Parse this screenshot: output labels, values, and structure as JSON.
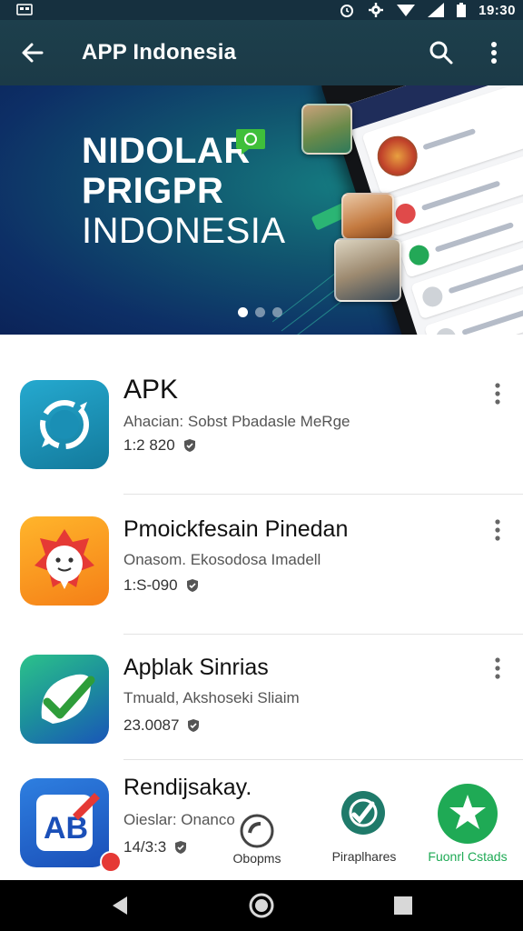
{
  "status_bar": {
    "time": "19:30"
  },
  "app_bar": {
    "title": "APP Indonesia"
  },
  "banner": {
    "line1": "NIDOLAR",
    "line2": "PRIGPR",
    "line3": "INDONESIA",
    "slide_count": 3,
    "active_slide": 1
  },
  "apps": [
    {
      "name": "APK",
      "desc": "Ahacian: Sobst Pbadasle MeRge",
      "count": "1:2 820",
      "icon": "sync-icon",
      "color": "#1a8fb5"
    },
    {
      "name": "Pmoickfesain Pinedan",
      "desc": "Onasom. Ekosodosa Imadell",
      "count": "1:S-090",
      "icon": "mascot-icon",
      "color": "#f7931e"
    },
    {
      "name": "Apþlak Sinrias",
      "desc": "Tmuald, Akshoseki Sliaim",
      "count": "23.0087",
      "icon": "checkmark-leaf-icon",
      "color": "#1f9c6b"
    },
    {
      "name": "Rendijsakay.",
      "desc": "Oieslar: Onanco",
      "count": "14/3:3",
      "icon": "ab-edit-icon",
      "color": "#1a5dc7"
    }
  ],
  "bottom_actions": [
    {
      "label": "Obopms",
      "icon": "disc-icon"
    },
    {
      "label": "Piraplhares",
      "icon": "edit-chat-icon"
    },
    {
      "label": "Fuonrl Cstads",
      "icon": "star-badge-icon"
    }
  ],
  "colors": {
    "app_bar": "#1b3a47",
    "accent_green": "#1faa55",
    "banner_dark": "#0b2358"
  }
}
